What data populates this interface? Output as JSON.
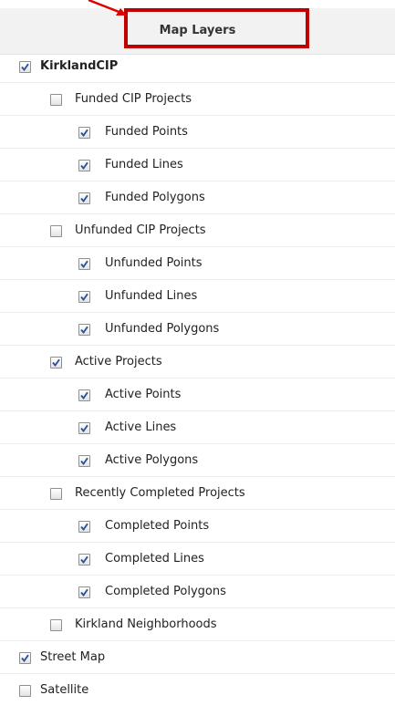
{
  "panel": {
    "title": "Map Layers"
  },
  "layers": [
    {
      "label": "KirklandCIP",
      "checked": true,
      "level": 0,
      "bold": true
    },
    {
      "label": "Funded CIP Projects",
      "checked": false,
      "level": 1
    },
    {
      "label": "Funded Points",
      "checked": true,
      "level": 2
    },
    {
      "label": "Funded Lines",
      "checked": true,
      "level": 2
    },
    {
      "label": "Funded Polygons",
      "checked": true,
      "level": 2
    },
    {
      "label": "Unfunded CIP Projects",
      "checked": false,
      "level": 1
    },
    {
      "label": "Unfunded Points",
      "checked": true,
      "level": 2
    },
    {
      "label": "Unfunded Lines",
      "checked": true,
      "level": 2
    },
    {
      "label": "Unfunded Polygons",
      "checked": true,
      "level": 2
    },
    {
      "label": "Active Projects",
      "checked": true,
      "level": 1
    },
    {
      "label": "Active Points",
      "checked": true,
      "level": 2
    },
    {
      "label": "Active Lines",
      "checked": true,
      "level": 2
    },
    {
      "label": "Active Polygons",
      "checked": true,
      "level": 2
    },
    {
      "label": "Recently Completed Projects",
      "checked": false,
      "level": 1
    },
    {
      "label": "Completed Points",
      "checked": true,
      "level": 2
    },
    {
      "label": "Completed Lines",
      "checked": true,
      "level": 2
    },
    {
      "label": "Completed Polygons",
      "checked": true,
      "level": 2
    },
    {
      "label": "Kirkland Neighborhoods",
      "checked": false,
      "level": 1
    },
    {
      "label": "Street Map",
      "checked": true,
      "level": 0
    },
    {
      "label": "Satellite",
      "checked": false,
      "level": 0
    }
  ],
  "colors": {
    "highlight": "#c00000",
    "check": "#2a4f9a",
    "header_bg": "#f2f2f2"
  }
}
